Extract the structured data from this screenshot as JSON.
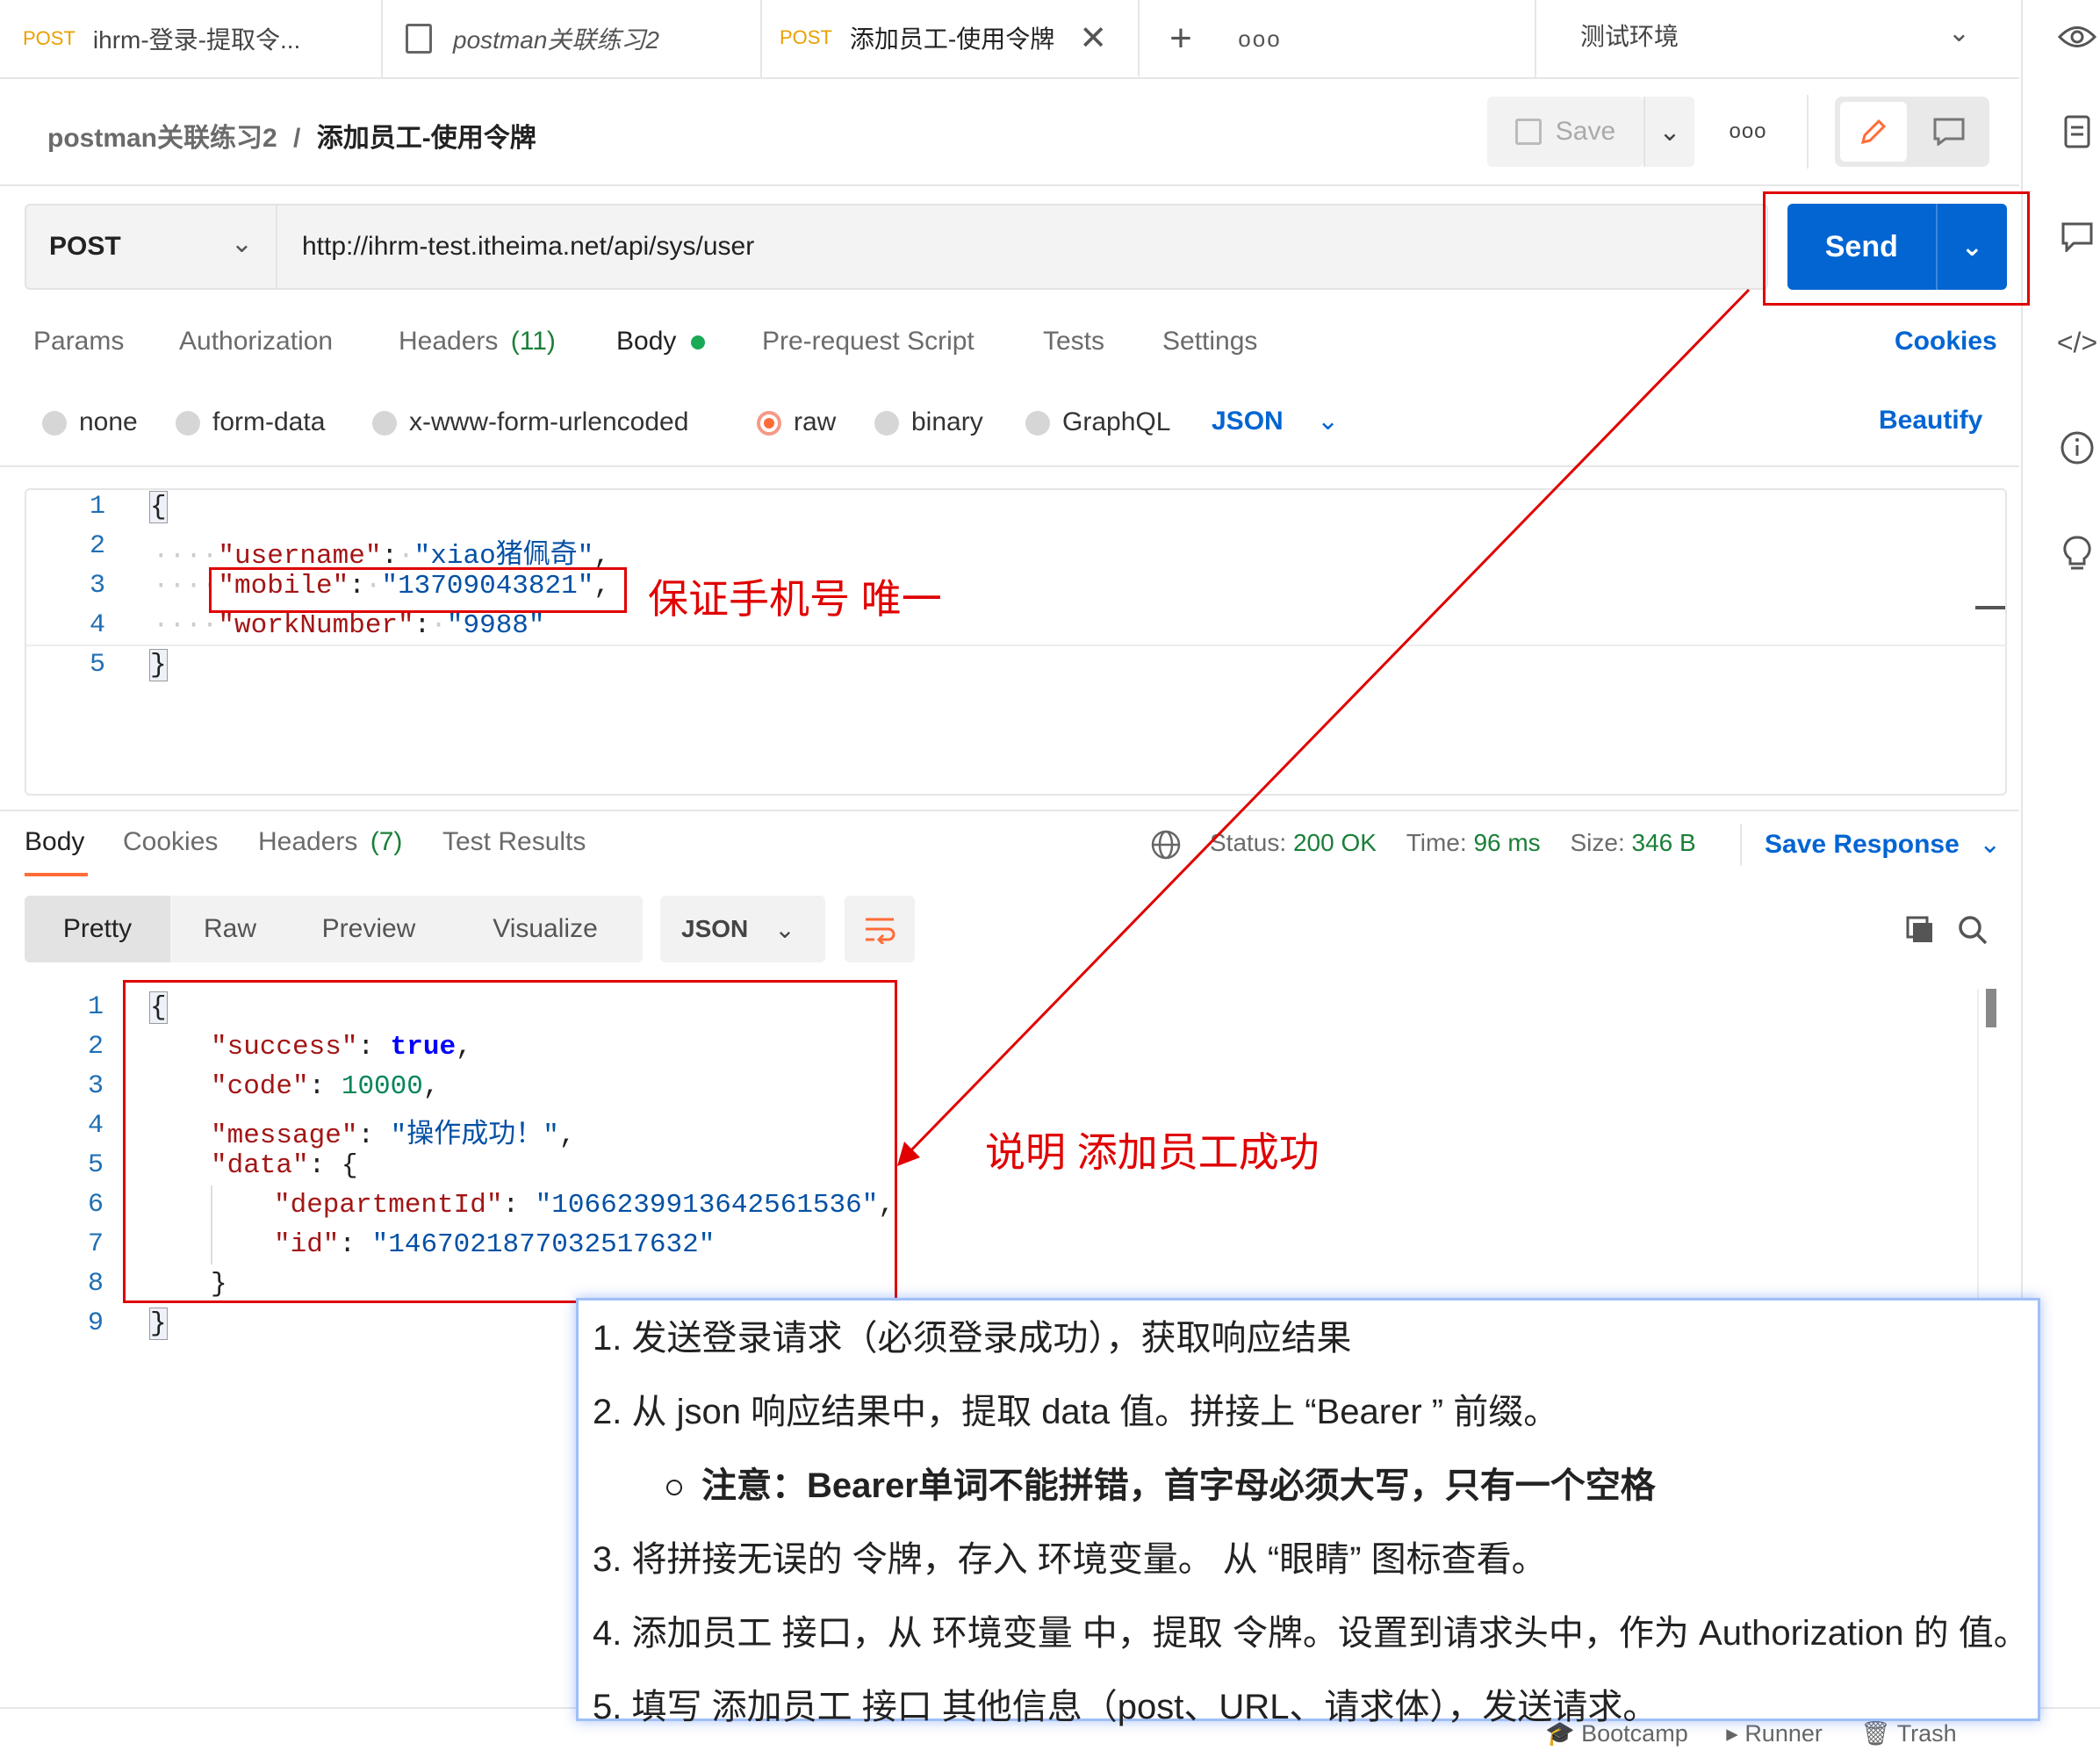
{
  "tabs": [
    {
      "method": "POST",
      "title": "ihrm-登录-提取令..."
    },
    {
      "method": "",
      "title": "postman关联练习2"
    },
    {
      "method": "POST",
      "title": "添加员工-使用令牌"
    }
  ],
  "environment": "测试环境",
  "breadcrumb": {
    "collection": "postman关联练习2",
    "sep": "/",
    "request": "添加员工-使用令牌"
  },
  "save_label": "Save",
  "request": {
    "method": "POST",
    "url": "http://ihrm-test.itheima.net/api/sys/user",
    "send_label": "Send",
    "tabs": [
      "Params",
      "Authorization",
      "Headers",
      "Body",
      "Pre-request Script",
      "Tests",
      "Settings"
    ],
    "headers_count": "(11)",
    "cookies_link": "Cookies",
    "body_types": [
      "none",
      "form-data",
      "x-www-form-urlencoded",
      "raw",
      "binary",
      "GraphQL"
    ],
    "body_format": "JSON",
    "beautify": "Beautify",
    "line_numbers": [
      "1",
      "2",
      "3",
      "4",
      "5"
    ],
    "body_lines": {
      "l1": "{",
      "username_key": "\"username\"",
      "username_val": "\"xiao猪佩奇\"",
      "mobile_key": "\"mobile\"",
      "mobile_val": "\"13709043821\"",
      "worknumber_key": "\"workNumber\"",
      "worknumber_val": "\"9988\"",
      "l5": "}"
    }
  },
  "annotations": {
    "mobile_note": "保证手机号 唯一",
    "success_note": "说明 添加员工成功"
  },
  "response": {
    "tabs": [
      "Body",
      "Cookies",
      "Headers",
      "Test Results"
    ],
    "headers_count": "(7)",
    "status_label": "Status:",
    "status_value": "200 OK",
    "time_label": "Time:",
    "time_value": "96 ms",
    "size_label": "Size:",
    "size_value": "346 B",
    "save_response": "Save Response",
    "view_modes": [
      "Pretty",
      "Raw",
      "Preview",
      "Visualize"
    ],
    "format": "JSON",
    "line_numbers": [
      "1",
      "2",
      "3",
      "4",
      "5",
      "6",
      "7",
      "8",
      "9"
    ],
    "body": {
      "success_key": "\"success\"",
      "success_val": "true",
      "code_key": "\"code\"",
      "code_val": "10000",
      "message_key": "\"message\"",
      "message_val": "\"操作成功！\"",
      "data_key": "\"data\"",
      "dept_key": "\"departmentId\"",
      "dept_val": "\"1066239913642561536\"",
      "id_key": "\"id\"",
      "id_val": "\"1467021877032517632\""
    }
  },
  "notes": {
    "n1": "1.  发送登录请求（必须登录成功），获取响应结果",
    "n2": "2.  从 json 响应结果中，提取 data 值。拼接上 “Bearer ” 前缀。",
    "n2a": "注意：Bearer单词不能拼错，首字母必须大写，只有一个空格",
    "n3": "3.  将拼接无误的 令牌，存入  环境变量。 从 “眼睛” 图标查看。",
    "n4": "4.  添加员工 接口，从 环境变量 中，提取 令牌。设置到请求头中，作为 Authorization 的 值。",
    "n5": "5.  填写 添加员工 接口 其他信息（post、URL、请求体），发送请求。"
  },
  "statusbar": [
    "Bootcamp",
    "Runner",
    "Trash"
  ],
  "colors": {
    "accent": "#0265d2",
    "postman_orange": "#ff6c37",
    "annotation_red": "#e00000",
    "success_green": "#1a7f37"
  }
}
